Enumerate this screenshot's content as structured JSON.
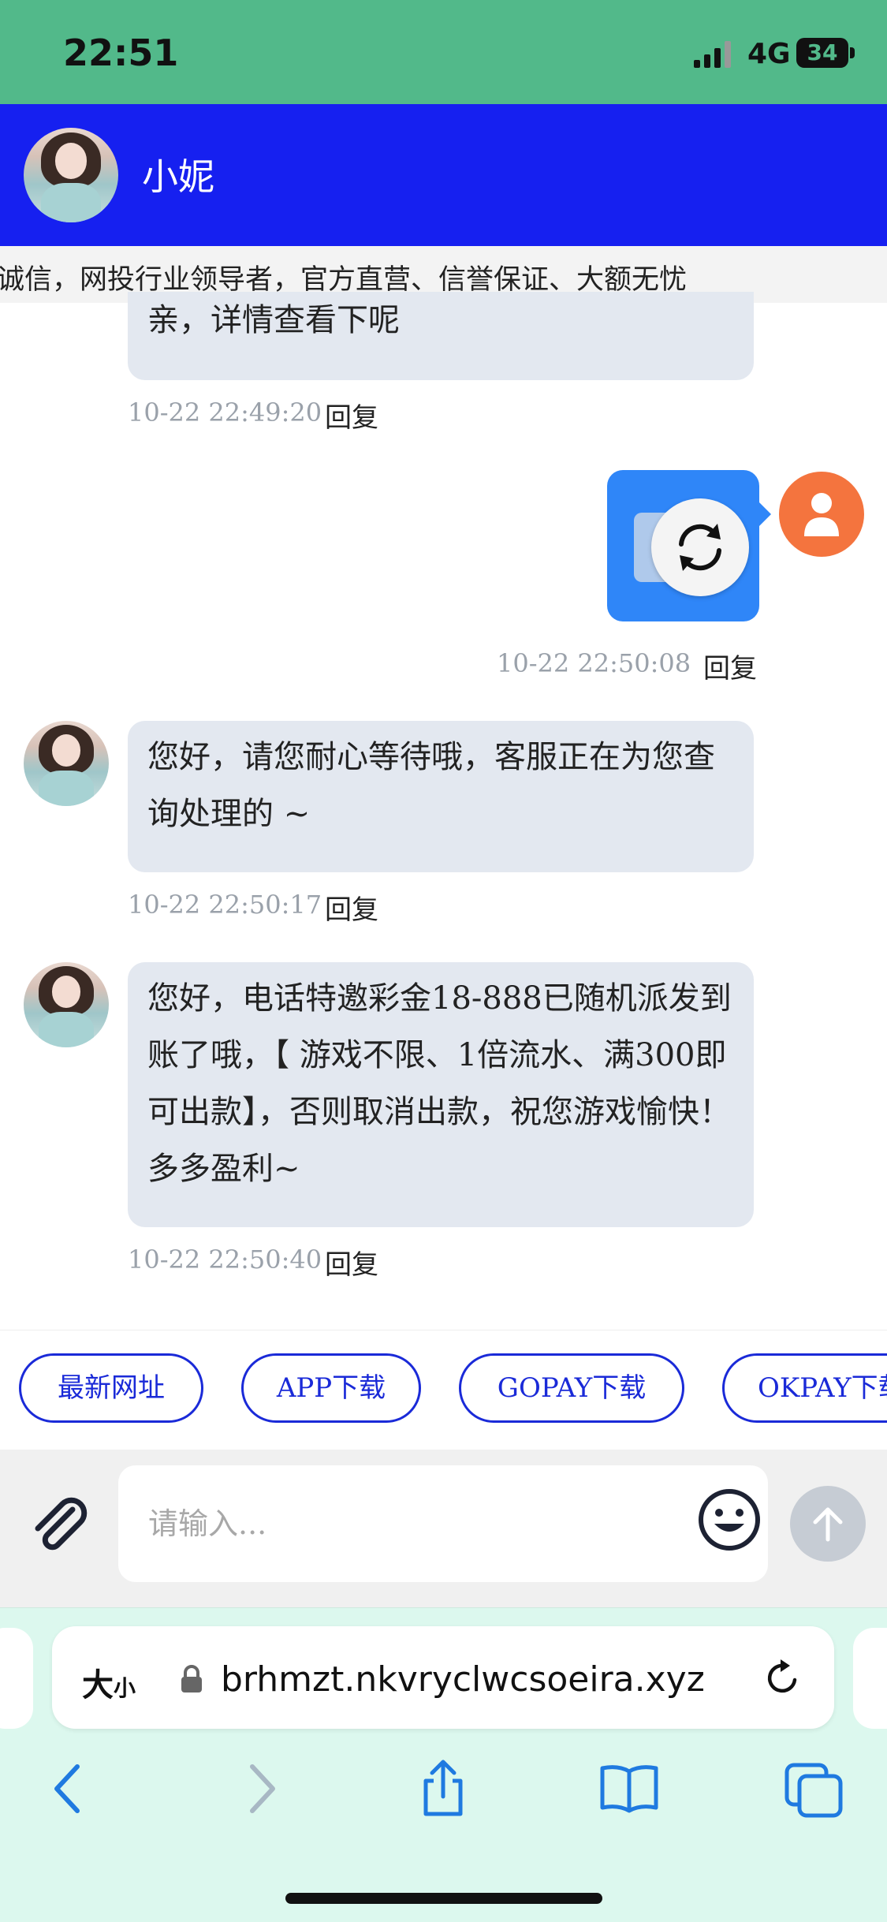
{
  "status_bar": {
    "time": "22:51",
    "network": "4G",
    "battery": "34"
  },
  "header": {
    "contact_name": "小妮"
  },
  "announcement": {
    "text": "诚信，网投行业领导者，官方直营、信誉保证、大额无忧"
  },
  "messages": [
    {
      "side": "left",
      "text": "亲，详情查看下呢",
      "time": "10-22 22:49:20",
      "reply_label": "回复"
    },
    {
      "side": "right",
      "type": "image",
      "time": "10-22 22:50:08",
      "reply_label": "回复"
    },
    {
      "side": "left",
      "text": "您好，请您耐心等待哦，客服正在为您查询处理的 ~",
      "time": "10-22 22:50:17",
      "reply_label": "回复"
    },
    {
      "side": "left",
      "text": "您好，电话特邀彩金18-888已随机派发到账了哦，【 游戏不限、1倍流水、满300即可出款】，否则取消出款，祝您游戏愉快！多多盈利~",
      "time": "10-22 22:50:40",
      "reply_label": "回复"
    }
  ],
  "quick_links": [
    "最新网址",
    "APP下载",
    "GOPAY下载",
    "OKPAY下载"
  ],
  "composer": {
    "placeholder": "请输入...",
    "value": ""
  },
  "browser": {
    "text_size_label": "大",
    "text_size_small": "小",
    "url": "brhmzt.nkvryclwcsoeira.xyz"
  },
  "icons": [
    "signal-icon",
    "battery-icon",
    "reload-icon",
    "user-icon",
    "paperclip-icon",
    "emoji-icon",
    "send-arrow-icon",
    "lock-icon",
    "refresh-icon",
    "back-icon",
    "forward-icon",
    "share-icon",
    "bookmarks-icon",
    "tabs-icon"
  ],
  "colors": {
    "status_bar": "#52b98a",
    "header": "#1620f0",
    "bubble": "#e3e8f0",
    "outgoing": "#2f86f8",
    "user_avatar": "#f4743e",
    "chip_border": "#1a2ad8",
    "safari_bar": "#dcf8ee"
  }
}
